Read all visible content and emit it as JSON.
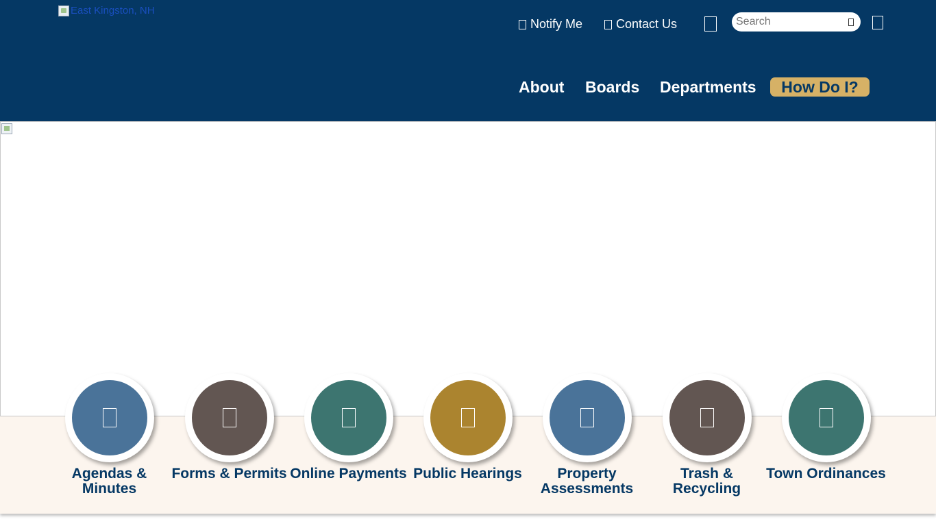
{
  "site": {
    "logo_alt": "East Kingston, NH"
  },
  "utility": {
    "notify_label": "Notify Me",
    "contact_label": "Contact Us",
    "search_placeholder": "Search"
  },
  "nav": {
    "items": [
      {
        "label": "About"
      },
      {
        "label": "Boards"
      },
      {
        "label": "Departments"
      },
      {
        "label": "How Do I?"
      }
    ]
  },
  "quick_links": [
    {
      "label": "Agendas & Minutes",
      "color": "#4a7399"
    },
    {
      "label": "Forms & Permits",
      "color": "#625652"
    },
    {
      "label": "Online Payments",
      "color": "#3d7570"
    },
    {
      "label": "Public Hearings",
      "color": "#ab842f"
    },
    {
      "label": "Property Assessments",
      "color": "#4a7399"
    },
    {
      "label": "Trash & Recycling",
      "color": "#625652"
    },
    {
      "label": "Town Ordinances",
      "color": "#3d7570"
    }
  ],
  "colors": {
    "header_bg": "#053864",
    "accent_gold": "#d6b166",
    "band_bg": "#fcf5ee"
  }
}
